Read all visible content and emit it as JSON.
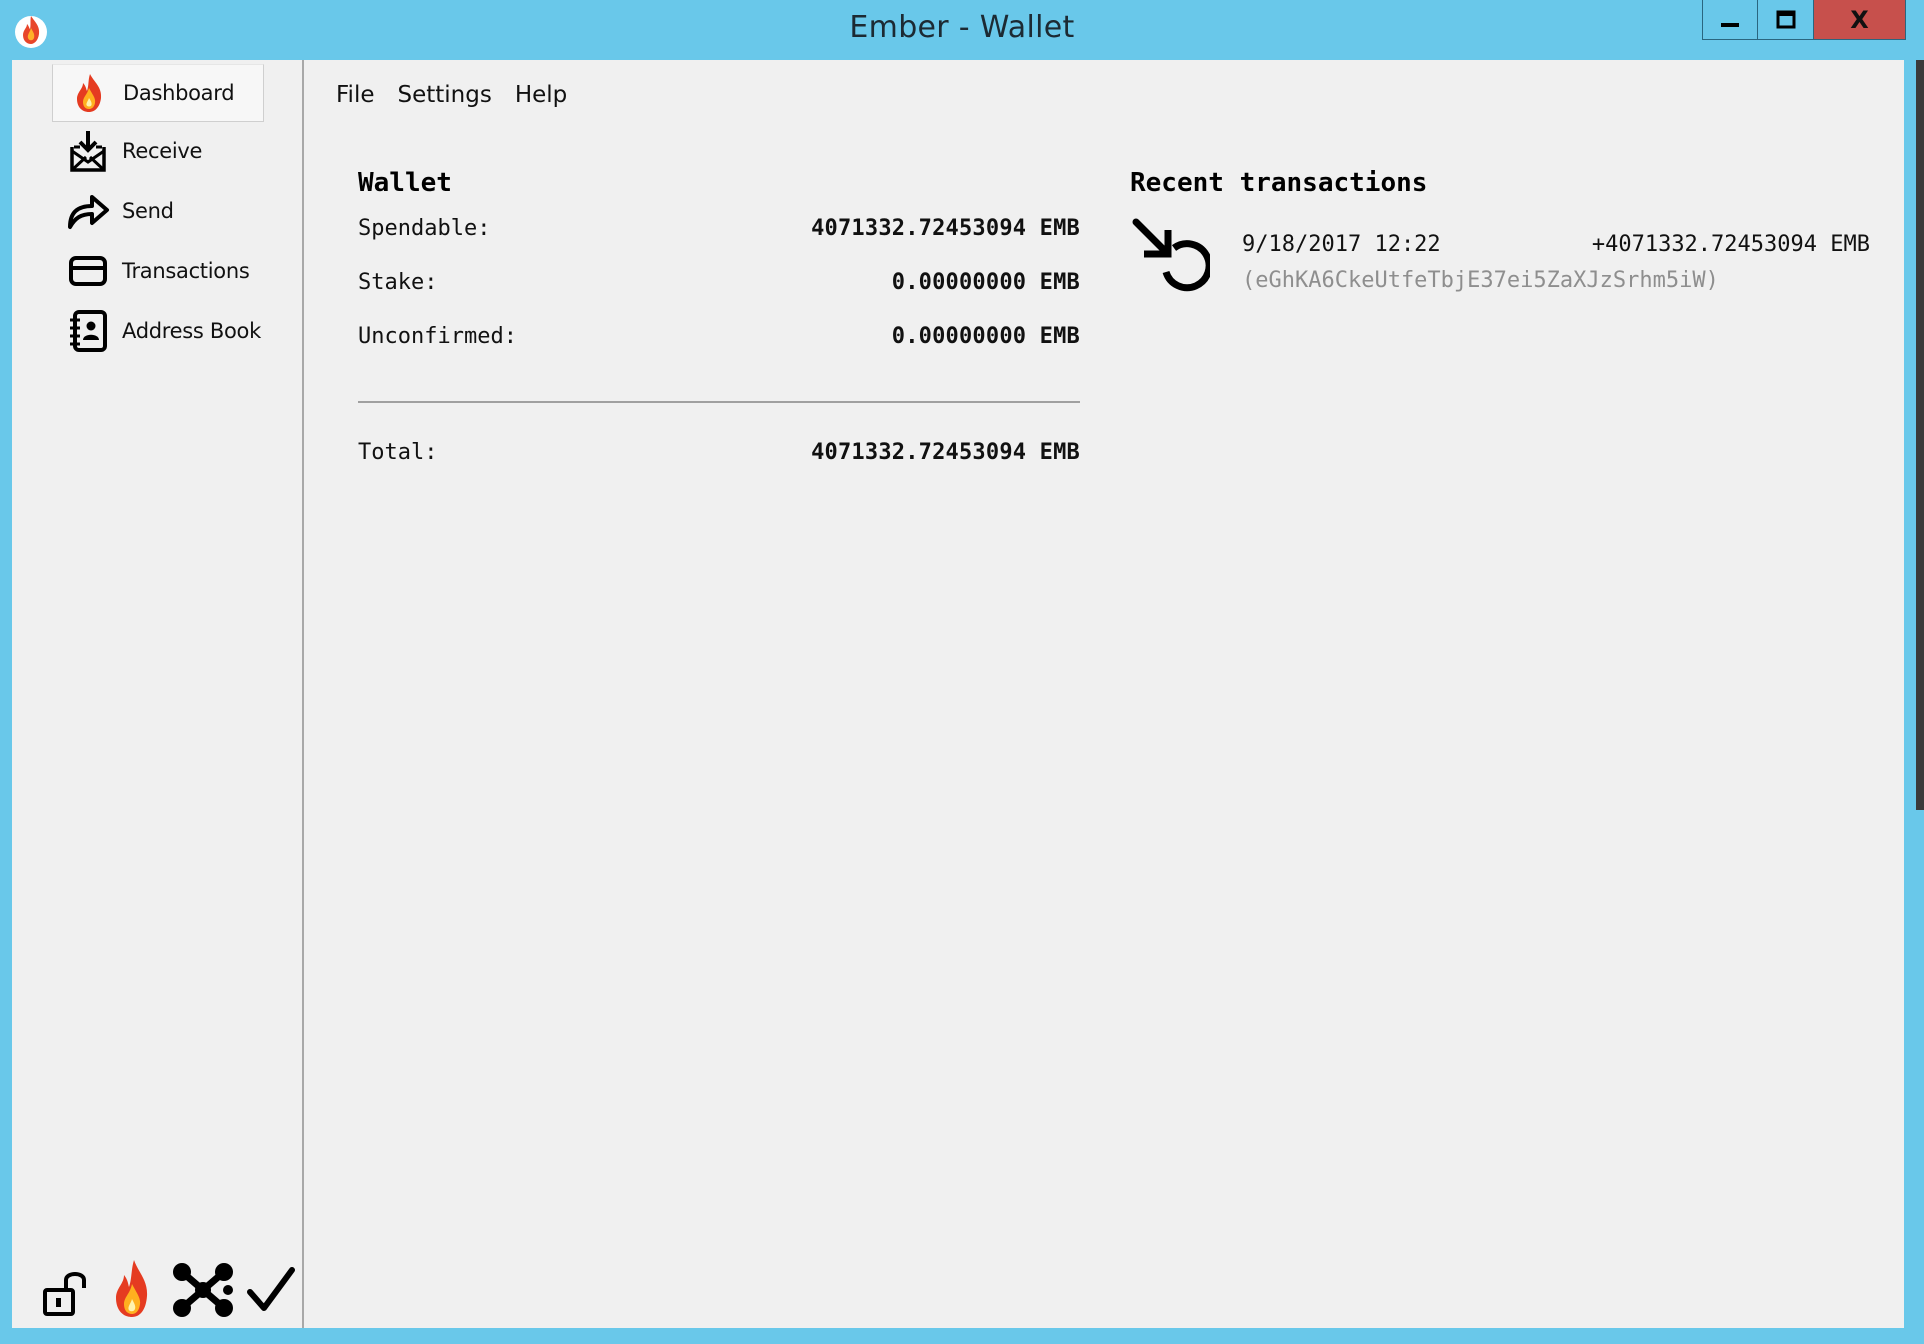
{
  "window": {
    "title": "Ember - Wallet",
    "controls": {
      "minimize_icon": "minimize-icon",
      "maximize_icon": "maximize-icon",
      "close_label": "X"
    },
    "colors": {
      "titlebar": "#69c8ea",
      "close": "#c7504c",
      "client": "#f0f0f0"
    }
  },
  "sidebar": {
    "items": [
      {
        "label": "Dashboard",
        "icon": "flame-icon",
        "active": true
      },
      {
        "label": "Receive",
        "icon": "receive-icon",
        "active": false
      },
      {
        "label": "Send",
        "icon": "send-arrow-icon",
        "active": false
      },
      {
        "label": "Transactions",
        "icon": "card-icon",
        "active": false
      },
      {
        "label": "Address Book",
        "icon": "address-book-icon",
        "active": false
      }
    ],
    "status_icons": [
      "unlock-icon",
      "flame-icon",
      "network-icon",
      "checkmark-icon"
    ]
  },
  "menu": {
    "items": [
      "File",
      "Settings",
      "Help"
    ]
  },
  "wallet": {
    "title": "Wallet",
    "rows": [
      {
        "label": "Spendable:",
        "value": "4071332.72453094 EMB"
      },
      {
        "label": "Stake:",
        "value": "0.00000000 EMB"
      },
      {
        "label": "Unconfirmed:",
        "value": "0.00000000 EMB"
      }
    ],
    "total": {
      "label": "Total:",
      "value": "4071332.72453094 EMB"
    }
  },
  "recent": {
    "title": "Recent transactions",
    "items": [
      {
        "icon": "incoming-pending-icon",
        "date": "9/18/2017 12:22",
        "amount": "+4071332.72453094 EMB",
        "address": "(eGhKA6CkeUtfeTbjE37ei5ZaXJzSrhm5iW)"
      }
    ]
  }
}
